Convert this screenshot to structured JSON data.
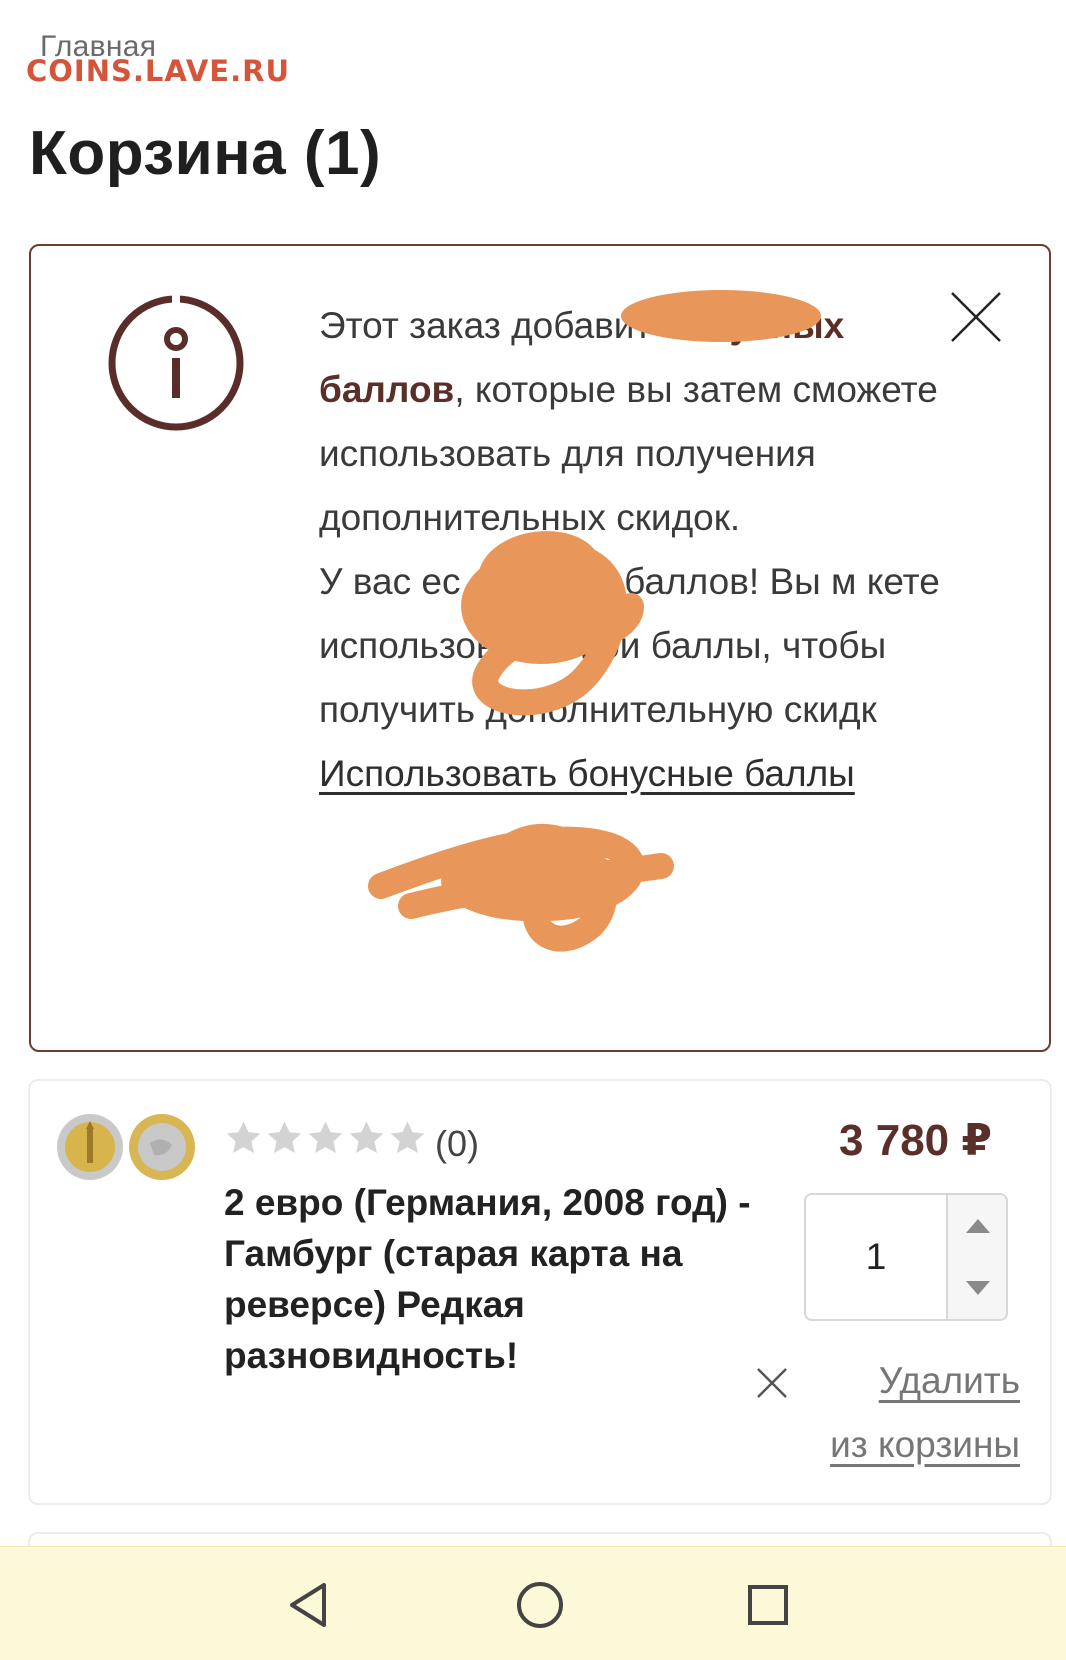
{
  "breadcrumb": {
    "home_label": "Главная"
  },
  "watermark": {
    "text": "COINS.LAVE.RU"
  },
  "page": {
    "title": "Корзина (1)"
  },
  "notice": {
    "line1": "Этот заказ добавит",
    "bold_text": "бонусных баллов",
    "line2": ", которые вы затем сможете использовать для получения дополнительных скидок.",
    "line3_start": "У вас ес",
    "line3_end": "онусных баллов! Вы м",
    "line4": "кете использовать свои баллы, чтобы получить дополнительную скидк",
    "link_label": "Использовать бонусные баллы",
    "icons": {
      "info": "info-icon",
      "close": "close-icon"
    },
    "colors": {
      "border": "#6b3b35",
      "scribble": "#e8965a"
    }
  },
  "cart": {
    "items": [
      {
        "rating_count": "(0)",
        "title": "2 евро (Германия, 2008 год) - Гамбург (старая карта на реверсе) Редкая разновидность!",
        "price": "3 780 ₽",
        "quantity": "1",
        "remove_label_1": "Удалить",
        "remove_label_2": "из корзины"
      }
    ]
  },
  "nav": {
    "icons": [
      "back-triangle-icon",
      "home-circle-icon",
      "recent-square-icon"
    ]
  },
  "colors": {
    "accent": "#5b2f29",
    "navbar_bg": "#fcf9d9",
    "star": "#d3d3d3"
  }
}
